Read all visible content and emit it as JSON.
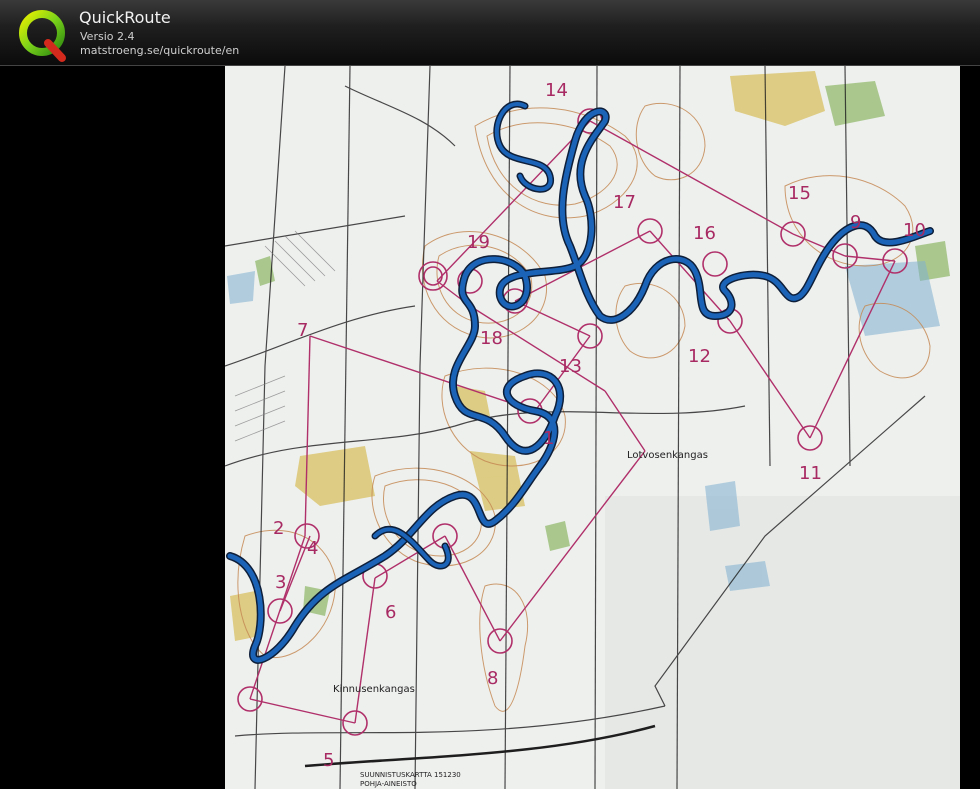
{
  "header": {
    "title": "QuickRoute",
    "version": "Versio 2.4",
    "url": "matstroeng.se/quickroute/en"
  },
  "map": {
    "area_labels": [
      "Lotvosenkangas",
      "Kinnusenkangas"
    ],
    "map_caption_line1": "SUUNNISTUSKARTTA 151230",
    "map_caption_line2": "POHJA-AINEISTO",
    "controls": [
      "1",
      "2",
      "3",
      "4",
      "5",
      "6",
      "7",
      "8",
      "9",
      "10",
      "11",
      "12",
      "13",
      "14",
      "15",
      "16",
      "17",
      "18",
      "19"
    ]
  },
  "colors": {
    "course": "#b0306a",
    "route": "#1a63b6",
    "route_edge": "#0e1f3a",
    "paper": "#eef0ee",
    "contour": "#c58a55"
  },
  "icons": [
    "quickroute-logo-icon"
  ]
}
